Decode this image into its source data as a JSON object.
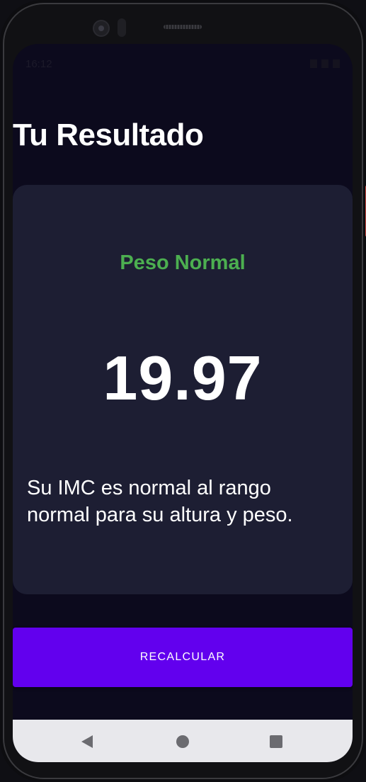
{
  "status_bar": {
    "time": "16:12"
  },
  "header": {
    "title": "Tu Resultado"
  },
  "result": {
    "category": "Peso Normal",
    "value": "19.97",
    "description": "Su IMC es normal al rango normal para su altura y peso."
  },
  "actions": {
    "recalculate_label": "RECALCULAR"
  },
  "colors": {
    "background": "#0c0a1d",
    "card": "#1d1e33",
    "category_green": "#4caf50",
    "button_purple": "#6200ee"
  },
  "icons": {
    "nav_back": "back-triangle-icon",
    "nav_home": "home-circle-icon",
    "nav_recents": "recents-square-icon"
  }
}
